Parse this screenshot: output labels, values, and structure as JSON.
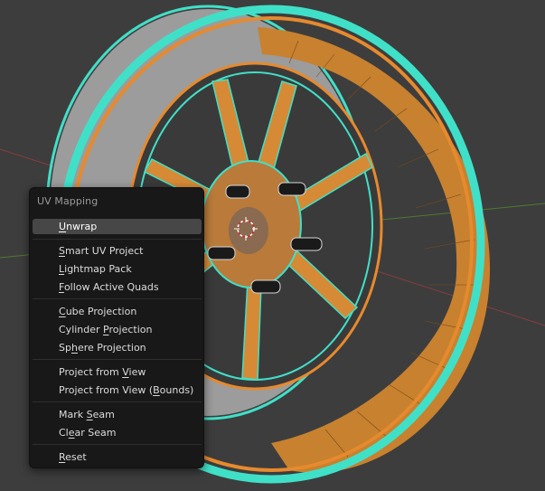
{
  "viewport": {
    "background": "#3d3d3d",
    "mesh_color": "#e68a2e",
    "selected_outline_color": "#40e0c8",
    "tire_color": "#a8a8a8",
    "object": "wheel-rim-mesh",
    "selection_state": "edit mode, all faces selected"
  },
  "uv_menu": {
    "title": "UV Mapping",
    "items": [
      {
        "label": "Unwrap",
        "ul_before": "",
        "ul_char": "U",
        "ul_after": "nwrap",
        "active": true
      },
      {
        "label": "Smart UV Project",
        "ul_before": "",
        "ul_char": "S",
        "ul_after": "mart UV Project"
      },
      {
        "label": "Lightmap Pack",
        "ul_before": "",
        "ul_char": "L",
        "ul_after": "ightmap Pack"
      },
      {
        "label": "Follow Active Quads",
        "ul_before": "",
        "ul_char": "F",
        "ul_after": "ollow Active Quads"
      },
      {
        "label": "Cube Projection",
        "ul_before": "",
        "ul_char": "C",
        "ul_after": "ube Projection"
      },
      {
        "label": "Cylinder Projection",
        "ul_before": "Cylinder ",
        "ul_char": "P",
        "ul_after": "rojection"
      },
      {
        "label": "Sphere Projection",
        "ul_before": "Sp",
        "ul_char": "h",
        "ul_after": "ere Projection"
      },
      {
        "label": "Project from View",
        "ul_before": "Project from ",
        "ul_char": "V",
        "ul_after": "iew"
      },
      {
        "label": "Project from View (Bounds)",
        "ul_before": "Project from View (",
        "ul_char": "B",
        "ul_after": "ounds)"
      },
      {
        "label": "Mark Seam",
        "ul_before": "Mark ",
        "ul_char": "S",
        "ul_after": "eam"
      },
      {
        "label": "Clear Seam",
        "ul_before": "Cl",
        "ul_char": "e",
        "ul_after": "ar Seam"
      },
      {
        "label": "Reset",
        "ul_before": "",
        "ul_char": "R",
        "ul_after": "eset"
      }
    ]
  }
}
